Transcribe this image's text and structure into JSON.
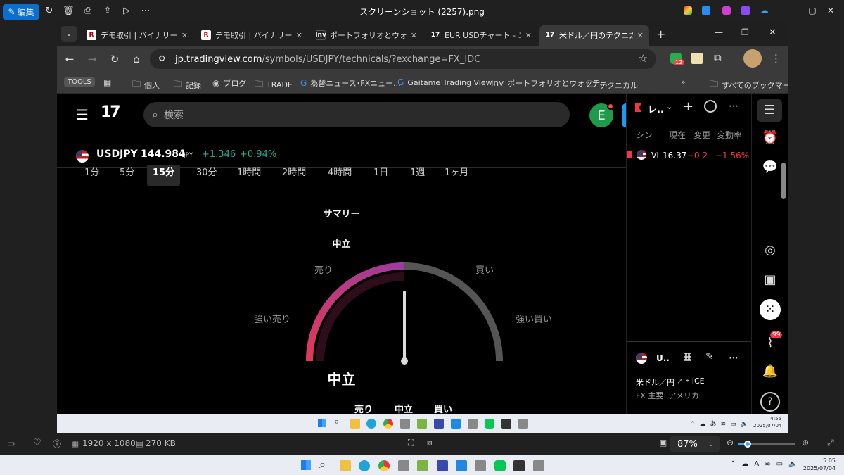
{
  "viewer": {
    "edit_label": "編集",
    "title": "スクリーンショット (2257).png",
    "dimensions": "1920 x 1080",
    "filesize": "270 KB",
    "zoom": "87%",
    "time": "5:05",
    "date": "2025/07/04"
  },
  "tabs": [
    {
      "title": "デモ取引 | バイナリーオプ",
      "fav": "R"
    },
    {
      "title": "デモ取引 | バイナリーオプ",
      "fav": "R"
    },
    {
      "title": "ポートフォリオとウォッチ・リ",
      "fav": "Inv"
    },
    {
      "title": "EUR USDチャート - ユーロ",
      "fav": "TV"
    },
    {
      "title": "米ドル／円のテクニカル分",
      "fav": "TV"
    }
  ],
  "url": {
    "host": "jp.tradingview.com",
    "path": "/symbols/USDJPY/technicals/?exchange=FX_IDC"
  },
  "bookmarks": [
    "TOOLS",
    "個人",
    "記録",
    "ブログ",
    "TRADE",
    "為替ニュース･FXニュー...",
    "Gaitame Trading View",
    "ポートフォリオとウォッチ...",
    "テクニカル",
    "すべてのブックマーク"
  ],
  "extension_badge": "12",
  "tv": {
    "search_placeholder": "検索",
    "avatar_letter": "E",
    "symbol": "USDJPY",
    "price": "144.984",
    "currency": "JPY",
    "change": "+1.346",
    "change_pct": "+0.94%",
    "timeframes": [
      "1分",
      "5分",
      "15分",
      "30分",
      "1時間",
      "2時間",
      "4時間",
      "1日",
      "1週",
      "1ヶ月"
    ],
    "active_timeframe": "15分",
    "gauge": {
      "title": "サマリー",
      "top_label": "中立",
      "sell": "売り",
      "buy": "買い",
      "strong_sell": "強い売り",
      "strong_buy": "強い買い",
      "result": "中立",
      "needle_value": 0.5
    },
    "bottom_counts": [
      "売り",
      "中立",
      "買い"
    ]
  },
  "watchlist": {
    "name": "レ..",
    "columns": [
      "シン",
      "現在",
      "変更",
      "変動率"
    ],
    "rows": [
      {
        "symbol": "VI",
        "last": "16.37",
        "chg": "−0.2(",
        "chg_pct": "−1.56%"
      }
    ]
  },
  "detail": {
    "symbol": "U..",
    "name": "米ドル／円",
    "exchange": "ICE",
    "sub": "FX 主要: アメリカ"
  },
  "rail_badge": "99",
  "inner_clock": {
    "time": "4:55",
    "date": "2025/07/04"
  },
  "colors": {
    "accent": "#0b6fcf",
    "up": "#22ab94",
    "down": "#f23645",
    "gauge_sell": "#e0385a",
    "gauge_mid": "#9c3ca0",
    "gauge_neutral": "#555555"
  }
}
